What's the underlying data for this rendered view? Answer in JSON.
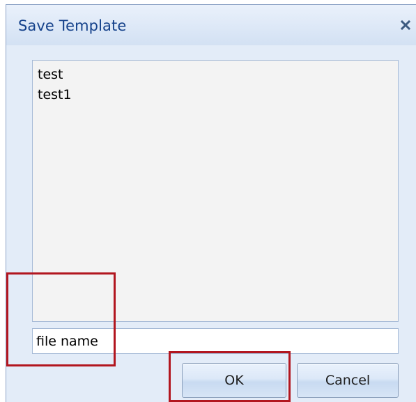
{
  "dialog": {
    "title": "Save Template",
    "close_icon": "close-x-icon"
  },
  "template_list": {
    "items": [
      {
        "label": "test"
      },
      {
        "label": "test1"
      }
    ]
  },
  "filename_field": {
    "value": "file name",
    "placeholder": ""
  },
  "buttons": {
    "ok_label": "OK",
    "cancel_label": "Cancel"
  },
  "colors": {
    "title_text": "#15428b",
    "highlight": "#b2161f",
    "dialog_bg": "#e3ecf8"
  }
}
